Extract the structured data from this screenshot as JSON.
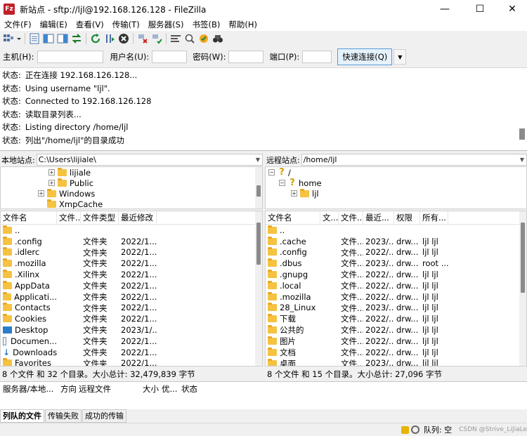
{
  "window": {
    "app_icon": "Fz",
    "title": "新站点 - sftp://ljl@192.168.126.128 - FileZilla",
    "minimize": "—",
    "maximize": "☐",
    "close": "✕"
  },
  "menu": [
    "文件(F)",
    "编辑(E)",
    "查看(V)",
    "传输(T)",
    "服务器(S)",
    "书签(B)",
    "帮助(H)"
  ],
  "toolbar": {
    "icons": [
      "site-manager-icon",
      "toggle-log-icon",
      "toggle-local-tree-icon",
      "toggle-remote-tree-icon",
      "toggle-queue-icon",
      "refresh-icon",
      "process-queue-icon",
      "cancel-icon",
      "disconnect-icon",
      "reconnect-icon",
      "filter-icon",
      "compare-icon",
      "sync-browse-icon",
      "search-icon"
    ]
  },
  "quickconnect": {
    "host_label": "主机(H):",
    "user_label": "用户名(U):",
    "pass_label": "密码(W):",
    "port_label": "端口(P):",
    "button": "快速连接(Q)",
    "host_value": "",
    "user_value": "",
    "pass_value": "",
    "port_value": ""
  },
  "log": [
    {
      "label": "状态:",
      "text": "正在连接 192.168.126.128..."
    },
    {
      "label": "状态:",
      "text": "Using username \"ljl\"."
    },
    {
      "label": "状态:",
      "text": "Connected to 192.168.126.128"
    },
    {
      "label": "状态:",
      "text": "读取目录列表..."
    },
    {
      "label": "状态:",
      "text": "Listing directory /home/ljl"
    },
    {
      "label": "状态:",
      "text": "列出\"/home/ljl\"的目录成功"
    }
  ],
  "local": {
    "label": "本地站点:",
    "path": "C:\\Users\\lijiale\\",
    "tree": [
      "lijiale",
      "Public",
      "Windows",
      "XmpCache"
    ],
    "headers": [
      "文件名",
      "文件...",
      "文件类型",
      "最近修改"
    ],
    "rows": [
      {
        "name": "..",
        "type": "",
        "modified": ""
      },
      {
        "name": ".config",
        "type": "文件夹",
        "modified": "2022/1..."
      },
      {
        "name": ".idlerc",
        "type": "文件夹",
        "modified": "2022/1..."
      },
      {
        "name": ".mozilla",
        "type": "文件夹",
        "modified": "2022/1..."
      },
      {
        "name": ".Xilinx",
        "type": "文件夹",
        "modified": "2022/1..."
      },
      {
        "name": "AppData",
        "type": "文件夹",
        "modified": "2022/1..."
      },
      {
        "name": "Applicati...",
        "type": "文件夹",
        "modified": "2022/1..."
      },
      {
        "name": "Contacts",
        "type": "文件夹",
        "modified": "2022/1..."
      },
      {
        "name": "Cookies",
        "type": "文件夹",
        "modified": "2022/1..."
      },
      {
        "name": "Desktop",
        "type": "文件夹",
        "modified": "2023/1/..."
      },
      {
        "name": "Documen...",
        "type": "文件夹",
        "modified": "2022/1..."
      },
      {
        "name": "Downloads",
        "type": "文件夹",
        "modified": "2022/1..."
      },
      {
        "name": "Favorites",
        "type": "文件夹",
        "modified": "2022/1..."
      }
    ],
    "status": "8 个文件 和 32 个目录。大小总计: 32,479,839 字节"
  },
  "remote": {
    "label": "远程站点:",
    "path": "/home/ljl",
    "tree": [
      "/",
      "home",
      "ljl"
    ],
    "headers": [
      "文件名",
      "文...",
      "文件...",
      "最近...",
      "权限",
      "所有..."
    ],
    "rows": [
      {
        "name": "..",
        "type": "",
        "modified": "",
        "perm": "",
        "owner": ""
      },
      {
        "name": ".cache",
        "type": "文件...",
        "modified": "2023/...",
        "perm": "drw...",
        "owner": "ljl ljl"
      },
      {
        "name": ".config",
        "type": "文件...",
        "modified": "2022/...",
        "perm": "drw...",
        "owner": "ljl ljl"
      },
      {
        "name": ".dbus",
        "type": "文件...",
        "modified": "2023/...",
        "perm": "drw...",
        "owner": "root ..."
      },
      {
        "name": ".gnupg",
        "type": "文件...",
        "modified": "2022/...",
        "perm": "drw...",
        "owner": "ljl ljl"
      },
      {
        "name": ".local",
        "type": "文件...",
        "modified": "2022/...",
        "perm": "drw...",
        "owner": "ljl ljl"
      },
      {
        "name": ".mozilla",
        "type": "文件...",
        "modified": "2022/...",
        "perm": "drw...",
        "owner": "ljl ljl"
      },
      {
        "name": "28_Linux",
        "type": "文件...",
        "modified": "2023/...",
        "perm": "drw...",
        "owner": "ljl ljl"
      },
      {
        "name": "下载",
        "type": "文件...",
        "modified": "2022/...",
        "perm": "drw...",
        "owner": "ljl ljl"
      },
      {
        "name": "公共的",
        "type": "文件...",
        "modified": "2022/...",
        "perm": "drw...",
        "owner": "ljl ljl"
      },
      {
        "name": "图片",
        "type": "文件...",
        "modified": "2022/...",
        "perm": "drw...",
        "owner": "ljl ljl"
      },
      {
        "name": "文档",
        "type": "文件...",
        "modified": "2022/...",
        "perm": "drw...",
        "owner": "ljl ljl"
      },
      {
        "name": "桌面",
        "type": "文件...",
        "modified": "2023/...",
        "perm": "drw...",
        "owner": "ljl ljl"
      }
    ],
    "status": "8 个文件 和 15 个目录。大小总计: 27,096 字节"
  },
  "queue": {
    "headers": [
      "服务器/本地...",
      "方向",
      "远程文件",
      "大小",
      "优...",
      "状态"
    ],
    "tabs": [
      "列队的文件",
      "传输失败",
      "成功的传输"
    ]
  },
  "statusbar": {
    "queue_text": "队列: 空",
    "watermark": "CSDN @Strive_LiJiaLe"
  },
  "colors": {
    "folder": "#f5c242",
    "accent": "#5b9bd5",
    "title_icon": "#c0202a"
  }
}
